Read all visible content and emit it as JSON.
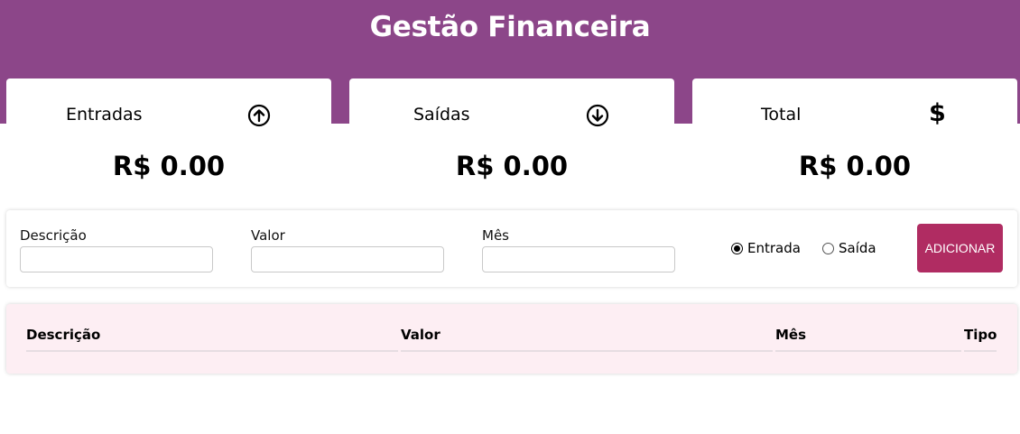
{
  "header": {
    "title": "Gestão Financeira",
    "background_color": "#8c4689"
  },
  "summary_cards": [
    {
      "label": "Entradas",
      "icon": "arrow-up-circle-icon",
      "value": "R$ 0.00"
    },
    {
      "label": "Saídas",
      "icon": "arrow-down-circle-icon",
      "value": "R$ 0.00"
    },
    {
      "label": "Total",
      "icon": "dollar-icon",
      "icon_glyph": "$",
      "value": "R$ 0.00"
    }
  ],
  "form": {
    "description_label": "Descrição",
    "description_value": "",
    "amount_label": "Valor",
    "amount_value": "",
    "month_label": "Mês",
    "month_value": "",
    "type_options": [
      {
        "label": "Entrada",
        "checked": true
      },
      {
        "label": "Saída",
        "checked": false
      }
    ],
    "add_button_label": "ADICIONAR",
    "add_button_color": "#b02c62"
  },
  "table": {
    "headers": [
      "Descrição",
      "Valor",
      "Mês",
      "Tipo"
    ],
    "rows": [],
    "background_color": "#fdeef3"
  }
}
